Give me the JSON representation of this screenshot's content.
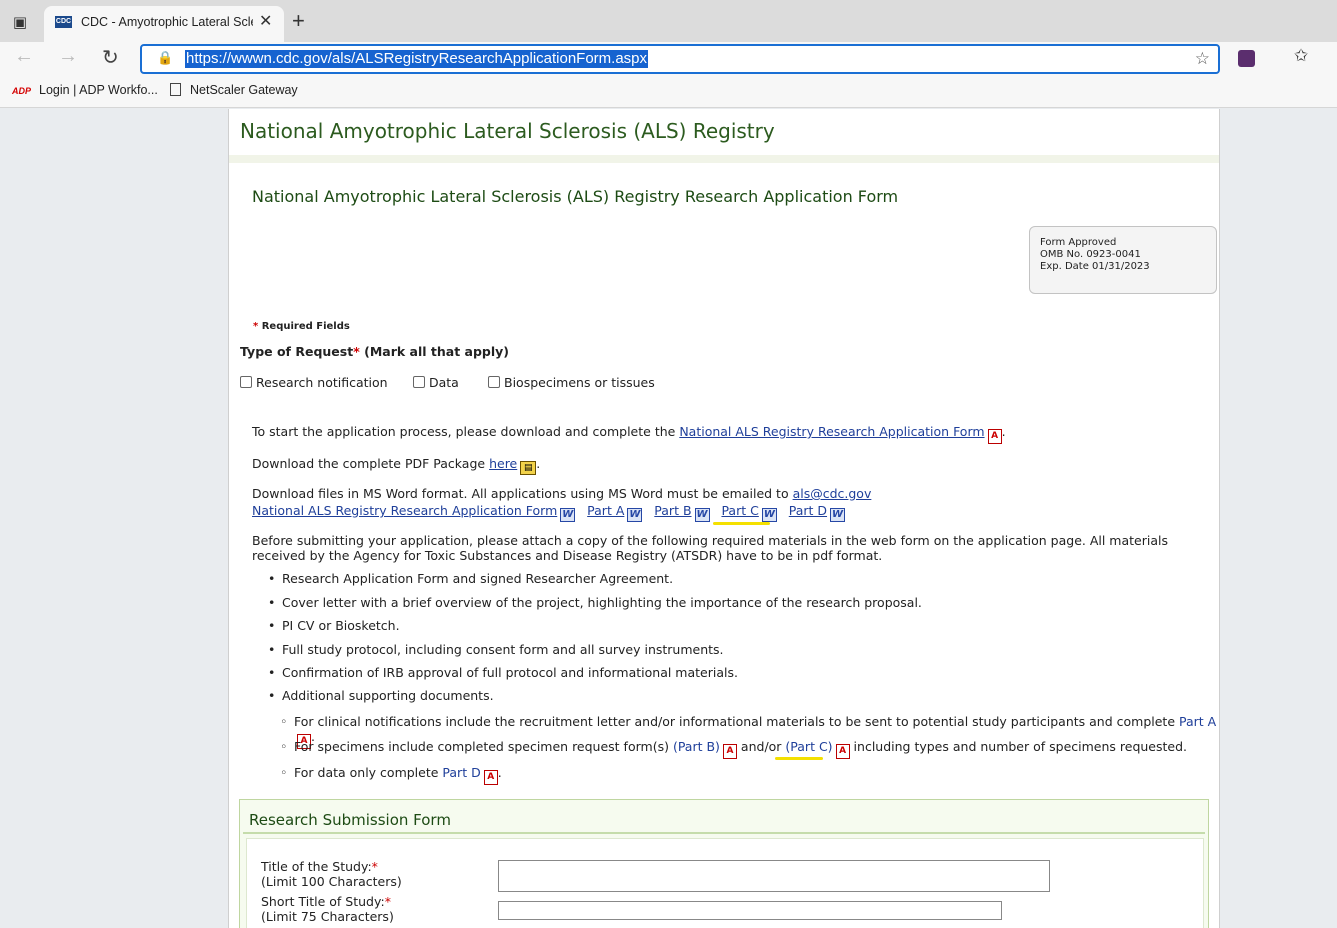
{
  "browser": {
    "tab_title": "CDC - Amyotrophic Lateral Sclerosis",
    "url": "https://wwwn.cdc.gov/als/ALSRegistryResearchApplicationForm.aspx",
    "bookmarks": [
      "Login | ADP Workfo...",
      "NetScaler Gateway"
    ],
    "favicon_text": "CDC",
    "adp_text": "ADP"
  },
  "page": {
    "site_title": "National Amyotrophic Lateral Sclerosis (ALS) Registry",
    "form_title": "National Amyotrophic Lateral Sclerosis (ALS) Registry Research Application Form",
    "omb": {
      "line1": "Form Approved",
      "line2": "OMB No. 0923-0041",
      "line3": "Exp. Date 01/31/2023"
    },
    "required_fields": "Required Fields",
    "type_of_request": "Type of Request",
    "mark_all": "(Mark all that apply)",
    "checkboxes": [
      "Research notification",
      "Data",
      "Biospecimens or tissues"
    ],
    "p1_text": "To start the application process, please download and complete the",
    "p1_link": "National ALS Registry Research Application Form",
    "p2_text": "Download the complete PDF Package",
    "p2_link": "here",
    "p3_text": "Download files in MS Word format. All applications using MS Word must be emailed to",
    "p3_email": "als@cdc.gov",
    "word_links": [
      "National ALS Registry Research Application Form",
      "Part A",
      "Part B",
      "Part C",
      "Part D"
    ],
    "p4_text": "Before submitting your application, please attach a copy of the following required materials in the web form on the application page. All materials received by the Agency for Toxic Substances and Disease Registry (ATSDR) have to be in pdf format.",
    "bullets": [
      "Research Application Form and signed Researcher Agreement.",
      "Cover letter with a brief overview of the project, highlighting the importance of the research proposal.",
      "PI CV or Biosketch.",
      "Full study protocol, including consent form and all survey instruments.",
      "Confirmation of IRB approval of full protocol and informational materials.",
      "Additional supporting documents."
    ],
    "sub1_text": "For clinical notifications include the recruitment letter and/or informational materials to be sent to potential study participants and complete",
    "sub1_link": "Part A",
    "sub2_text": "For specimens include completed specimen request form(s)",
    "sub2_link1": "(Part B)",
    "sub2_mid": "and/or",
    "sub2_link2": "(Part C)",
    "sub2_end": "including types and number of specimens requested.",
    "sub3_text": "For data only complete",
    "sub3_link": "Part D",
    "rsf_title": "Research Submission Form",
    "field1_label": "Title of the Study:",
    "field1_hint": "(Limit 100 Characters)",
    "field2_label": "Short Title of Study:",
    "field2_hint": "(Limit 75 Characters)"
  },
  "colors": {
    "accent": "#2c5b1f",
    "link": "#1f3f9a",
    "highlight": "#f4e000",
    "required": "#cc0000"
  }
}
